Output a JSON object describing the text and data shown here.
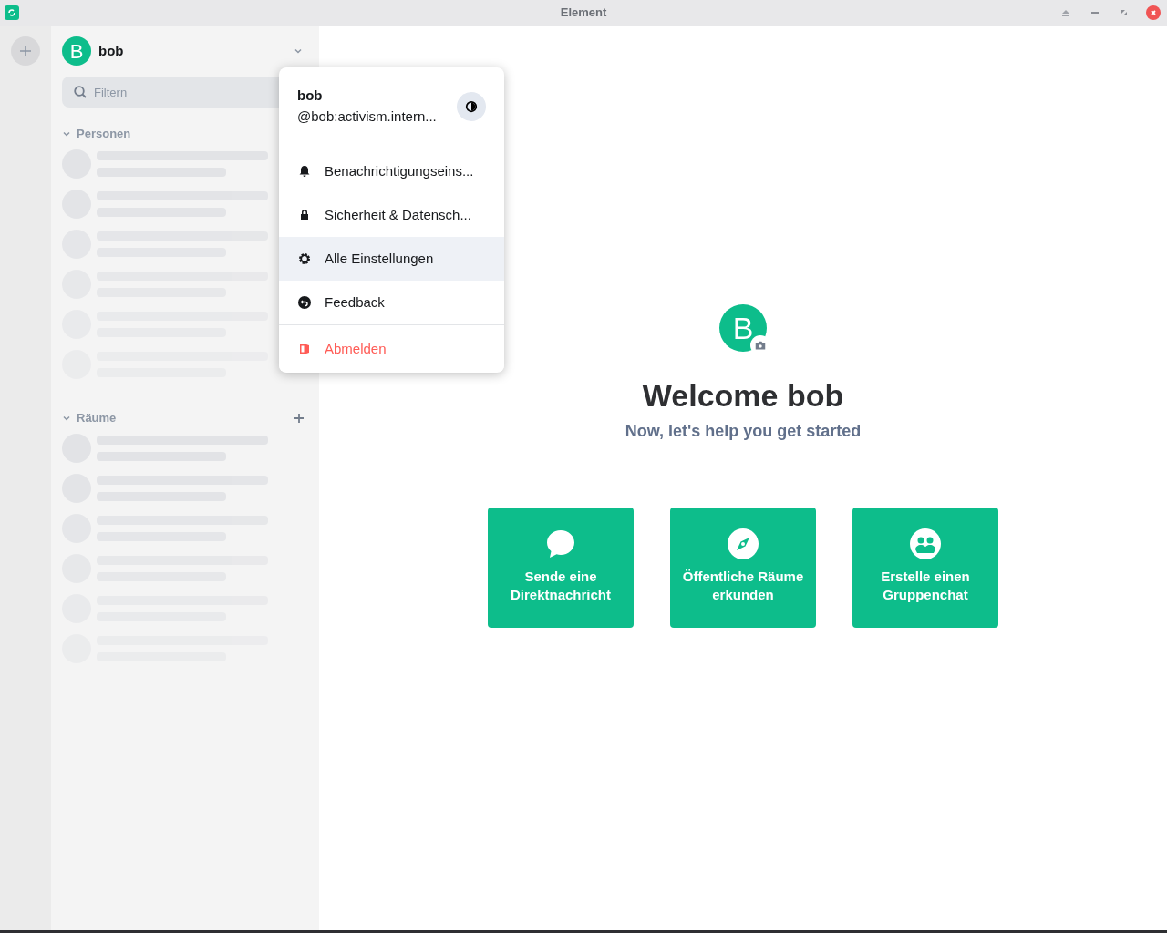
{
  "window": {
    "title": "Element"
  },
  "user_header": {
    "avatar_letter": "B",
    "name": "bob"
  },
  "search": {
    "placeholder": "Filtern"
  },
  "sections": [
    {
      "label": "Personen",
      "expanded": true,
      "has_add": false
    },
    {
      "label": "Räume",
      "expanded": true,
      "has_add": true
    }
  ],
  "user_menu": {
    "name": "bob",
    "user_id": "@bob:activism.intern...",
    "items": [
      {
        "label": "Benachrichtigungseins...",
        "kind": "normal",
        "highlighted": false
      },
      {
        "label": "Sicherheit & Datensch...",
        "kind": "normal",
        "highlighted": false
      },
      {
        "label": "Alle Einstellungen",
        "kind": "normal",
        "highlighted": true
      },
      {
        "label": "Feedback",
        "kind": "normal",
        "highlighted": false
      },
      {
        "label": "Abmelden",
        "kind": "danger",
        "highlighted": false
      }
    ]
  },
  "welcome": {
    "avatar_letter": "B",
    "title": "Welcome bob",
    "subtitle": "Now, let's help you get started",
    "actions": [
      {
        "label": "Sende eine Direktnachricht"
      },
      {
        "label": "Öffentliche Räume erkunden"
      },
      {
        "label": "Erstelle einen Gruppenchat"
      }
    ]
  }
}
